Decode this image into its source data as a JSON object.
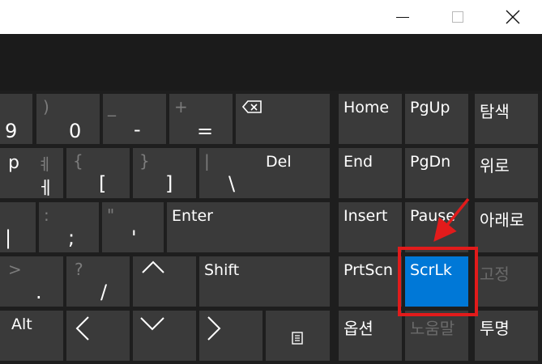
{
  "window": {
    "controls": [
      "minimize-icon",
      "maximize-icon",
      "close-icon"
    ]
  },
  "keys": {
    "k9": {
      "main": "9"
    },
    "k0": {
      "top": ")",
      "main": "0"
    },
    "kminus": {
      "top": "_",
      "main": "-"
    },
    "kequal": {
      "top": "+",
      "main": "="
    },
    "kbackspace": {
      "icon": "backspace-icon"
    },
    "kp": {
      "main": "p",
      "sub": "ㅔ"
    },
    "kbracketopen_sec": {
      "top": "ㅖ",
      "main": "ㅔ"
    },
    "kbrace_open": {
      "top": "{",
      "main": "["
    },
    "kbrace_close": {
      "top": "}",
      "main": "]"
    },
    "kpipe": {
      "top": "|",
      "main": "\\"
    },
    "kdel": {
      "main": "Del"
    },
    "kcolon": {
      "top": ":",
      "main": ";"
    },
    "kquote": {
      "top": "\"",
      "main": "'"
    },
    "kenter": {
      "main": "Enter"
    },
    "kleftbar": {
      "main": "|"
    },
    "kgt": {
      "top": ">",
      "main": "."
    },
    "kquestion": {
      "top": "?",
      "main": "/"
    },
    "kup": {
      "main": "^"
    },
    "kshift": {
      "main": "Shift"
    },
    "kalt": {
      "main": "Alt"
    },
    "kleft": {
      "main": "<"
    },
    "kdown": {
      "main": "v"
    },
    "kright": {
      "main": ">"
    },
    "kmenu": {
      "icon": "menu-icon"
    },
    "home": {
      "main": "Home"
    },
    "pgup": {
      "main": "PgUp"
    },
    "nav1": {
      "main": "탐색"
    },
    "end": {
      "main": "End"
    },
    "pgdn": {
      "main": "PgDn"
    },
    "nav2": {
      "main": "위로"
    },
    "insert": {
      "main": "Insert"
    },
    "pause": {
      "main": "Pause"
    },
    "nav3": {
      "main": "아래로"
    },
    "prtscn": {
      "main": "PrtScn"
    },
    "scrlk": {
      "main": "ScrLk"
    },
    "nav4": {
      "main": "고정"
    },
    "options": {
      "main": "옵션"
    },
    "noembal": {
      "main": "노움말"
    },
    "trans": {
      "main": "투명"
    }
  },
  "colors": {
    "key_bg": "#3a3a3a",
    "selected": "#0078d7",
    "highlight": "#e21b1b"
  }
}
